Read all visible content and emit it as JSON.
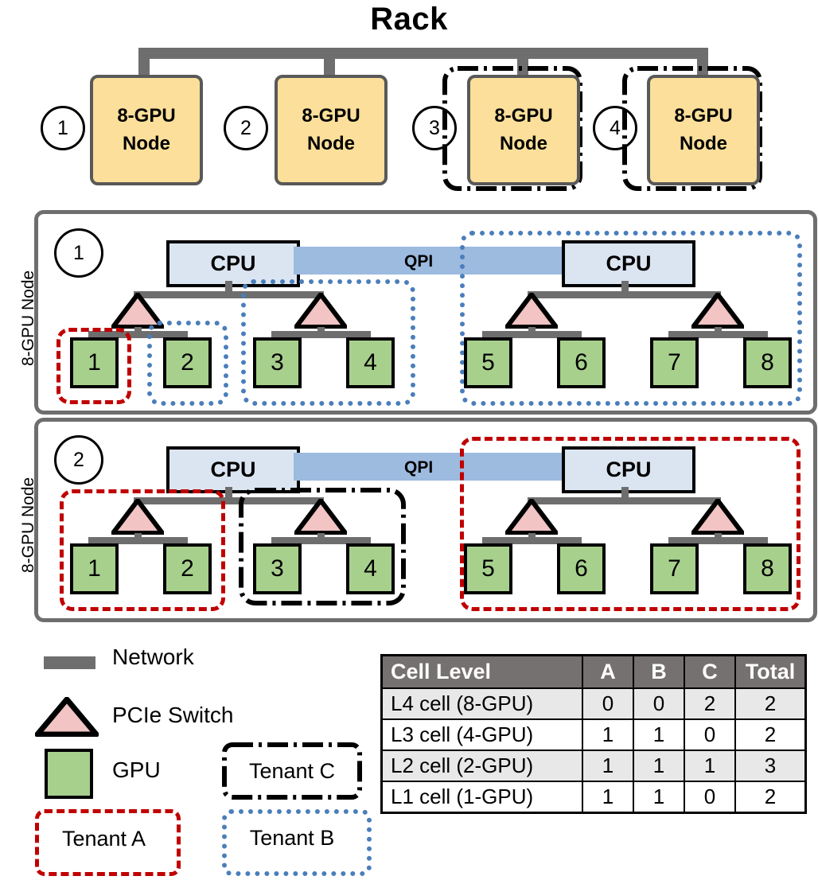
{
  "title": "Rack",
  "colors": {
    "network": "#6e6e6e",
    "node_fill": "#fbdf9a",
    "cpu_fill": "#dbe5f1",
    "qpi_fill": "#9dbadf",
    "gpu_fill": "#a8d08d",
    "switch_fill": "#f2c4c4",
    "tenant_a": "#c00000",
    "tenant_b": "#4a7ebb",
    "tenant_c": "#000000",
    "table_header": "#767171",
    "table_row_alt": "#e8e8e8"
  },
  "rack": {
    "nodes": [
      {
        "index": "1",
        "label_line1": "8-GPU",
        "label_line2": "Node",
        "tenant": ""
      },
      {
        "index": "2",
        "label_line1": "8-GPU",
        "label_line2": "Node",
        "tenant": ""
      },
      {
        "index": "3",
        "label_line1": "8-GPU",
        "label_line2": "Node",
        "tenant": "C"
      },
      {
        "index": "4",
        "label_line1": "8-GPU",
        "label_line2": "Node",
        "tenant": "C"
      }
    ]
  },
  "node_detail": {
    "side_label": "8-GPU Node",
    "cpu_label": "CPU",
    "qpi_label": "QPI",
    "node1": {
      "index": "1",
      "gpus": [
        "1",
        "2",
        "3",
        "4",
        "5",
        "6",
        "7",
        "8"
      ],
      "tenants": [
        {
          "name": "Tenant A",
          "scope": "gpu-1"
        },
        {
          "name": "Tenant B",
          "scope": "gpu-2"
        },
        {
          "name": "Tenant B",
          "scope": "switch-2-gpus-3-4"
        },
        {
          "name": "Tenant B",
          "scope": "cpu-2-gpus-5-8"
        }
      ]
    },
    "node2": {
      "index": "2",
      "gpus": [
        "1",
        "2",
        "3",
        "4",
        "5",
        "6",
        "7",
        "8"
      ],
      "tenants": [
        {
          "name": "Tenant A",
          "scope": "switch-1-gpus-1-2"
        },
        {
          "name": "Tenant C",
          "scope": "switch-2-gpus-3-4"
        },
        {
          "name": "Tenant A",
          "scope": "cpu-2-gpus-5-8"
        }
      ]
    }
  },
  "legend": {
    "network": "Network",
    "pcie_switch": "PCIe Switch",
    "gpu": "GPU",
    "tenant_a": "Tenant A",
    "tenant_b": "Tenant B",
    "tenant_c": "Tenant C"
  },
  "chart_data": {
    "type": "table",
    "title": "Cell Level allocation counts per tenant",
    "columns": [
      "Cell Level",
      "A",
      "B",
      "C",
      "Total"
    ],
    "rows": [
      {
        "level": "L4 cell (8-GPU)",
        "a": "0",
        "b": "0",
        "c": "2",
        "total": "2"
      },
      {
        "level": "L3 cell (4-GPU)",
        "a": "1",
        "b": "1",
        "c": "0",
        "total": "2"
      },
      {
        "level": "L2 cell (2-GPU)",
        "a": "1",
        "b": "1",
        "c": "1",
        "total": "3"
      },
      {
        "level": "L1 cell (1-GPU)",
        "a": "1",
        "b": "1",
        "c": "0",
        "total": "2"
      }
    ]
  }
}
